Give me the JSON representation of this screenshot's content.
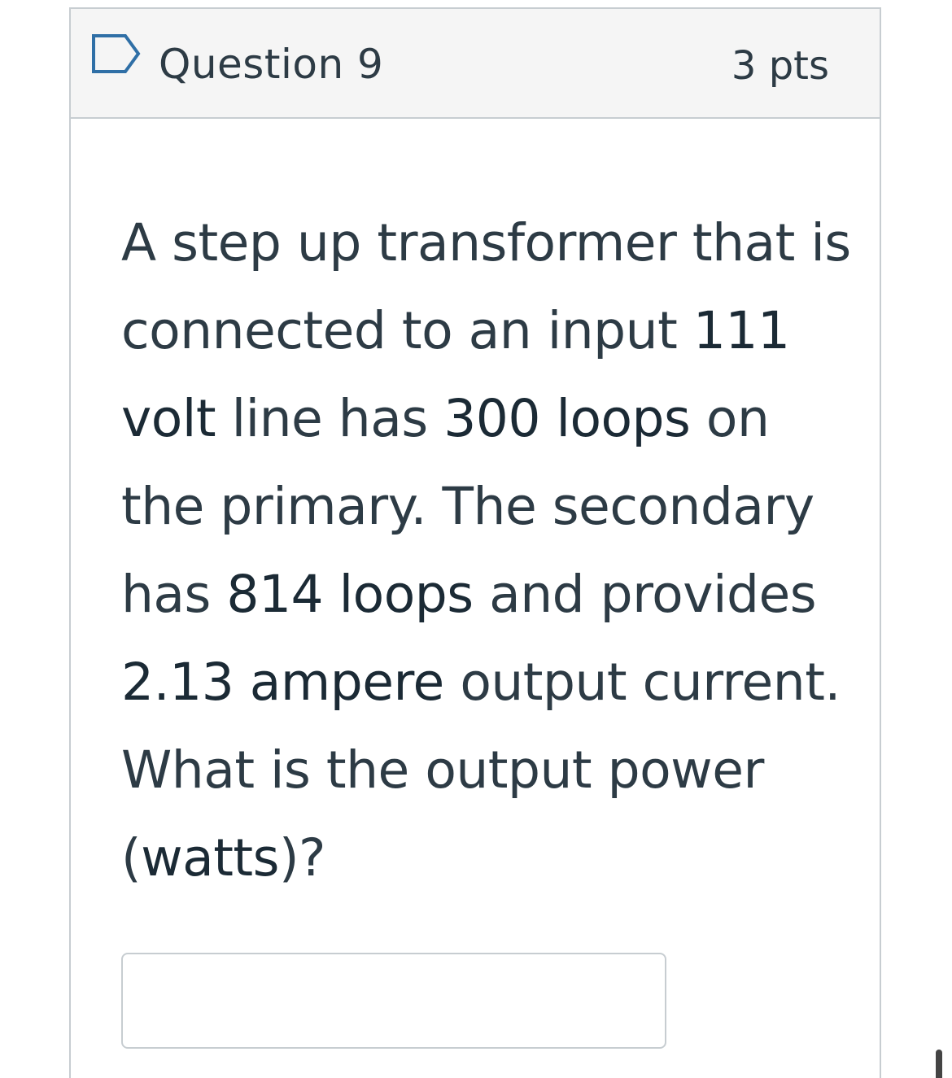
{
  "question": {
    "title": "Question 9",
    "points": "3 pts",
    "text_segments": [
      "A step up transformer that is connected to an input ",
      "111 volt",
      " line has ",
      "300 loops",
      " on the primary. The secondary has ",
      "814 loops",
      " and provides ",
      "2.13 ampere",
      " output current. What is the output power (",
      "watts",
      ")?"
    ],
    "answer": {
      "value": "",
      "placeholder": ""
    }
  },
  "icons": {
    "flag": "flag-icon"
  },
  "colors": {
    "header_bg": "#f5f5f5",
    "border": "#c7cdd1",
    "text": "#2d3b45",
    "flag_outline": "#2f6fa6"
  }
}
